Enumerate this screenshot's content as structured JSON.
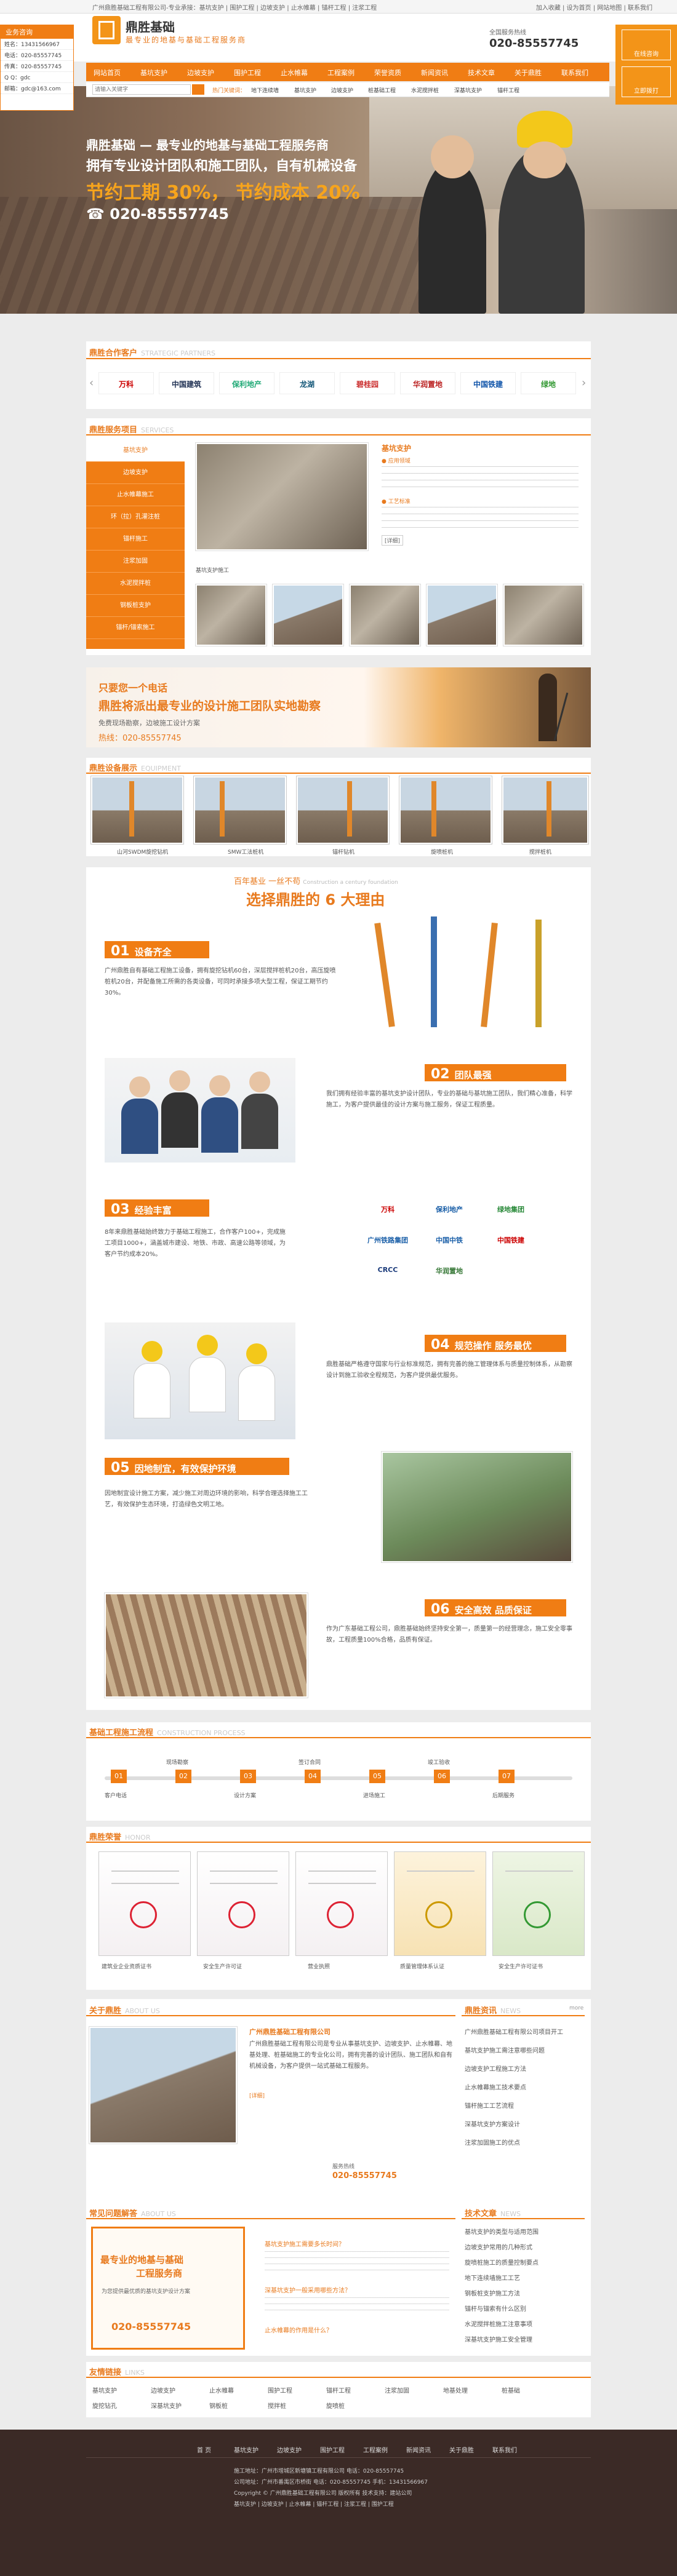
{
  "topbar": {
    "left": "广州鼎胜基础工程有限公司-专业承接：基坑支护 | 围护工程 | 边坡支护 | 止水帷幕 | 锚杆工程 | 注浆工程",
    "right": "加入收藏 | 设为首页 | 网站地图 | 联系我们"
  },
  "header": {
    "name": "鼎胜基础",
    "slogan": "最专业的地基与基础工程服务商",
    "hotline_label": "全国服务热线",
    "hotline": "020-85557745"
  },
  "nav": [
    "网站首页",
    "基坑支护",
    "边坡支护",
    "围护工程",
    "止水帷幕",
    "工程案例",
    "荣誉资质",
    "新闻资讯",
    "技术文章",
    "关于鼎胜",
    "联系我们"
  ],
  "subnav": {
    "search_ph": "请输入关键字",
    "hot": "热门关键词：",
    "keys": [
      "地下连续墙",
      "基坑支护",
      "边坡支护",
      "桩基础工程",
      "水泥搅拌桩",
      "深基坑支护",
      "锚杆工程"
    ]
  },
  "leftbox": {
    "title": "业务咨询",
    "rows": [
      "姓名：13431566967",
      "电话：020-85557745",
      "传真：020-85557745",
      "Q Q：gdc",
      "邮箱：gdc@163.com"
    ]
  },
  "floatr": {
    "b1": "在线咨询",
    "b2": "立即拨打"
  },
  "hero": {
    "t1": "鼎胜基础 — 最专业的地基与基础工程服务商",
    "t2": "拥有专业设计团队和施工团队，自有机械设备",
    "t3": "节约工期 30%， 节约成本 20%",
    "t4": "☎ 020-85557745"
  },
  "partners": {
    "title": "鼎胜合作客户",
    "en": "STRATEGIC PARTNERS",
    "items": [
      "万科",
      "中国建筑",
      "保利地产",
      "龙湖",
      "碧桂园",
      "华润置地",
      "中国铁建",
      "绿地"
    ]
  },
  "services": {
    "title": "鼎胜服务项目",
    "en": "SERVICES",
    "menu": [
      "基坑支护",
      "边坡支护",
      "止水帷幕施工",
      "环（拉）孔灌注桩",
      "锚杆施工",
      "注浆加固",
      "水泥搅拌桩",
      "钢板桩支护",
      "锚杆/锚索施工"
    ],
    "feature_title": "基坑支护",
    "feature_sub": "● 应用领域",
    "feature_sub2": "● 工艺标准",
    "feature_more": "[详细]",
    "caption": "基坑支护施工"
  },
  "banner2": {
    "t1": "只要您一个电话",
    "t2": "鼎胜将派出最专业的设计施工团队实地勘察",
    "t3": "免费现场勘察，边坡施工设计方案",
    "t4": "热线：020-85557745"
  },
  "equipment": {
    "title": "鼎胜设备展示",
    "en": "EQUIPMENT",
    "items": [
      "山河SWDM旋挖钻机",
      "SMW工法桩机",
      "锚杆钻机",
      "旋喷桩机",
      "搅拌桩机",
      "三轴搅拌桩机"
    ]
  },
  "why": {
    "top": "百年基业 一丝不苟",
    "top_en": "Construction a century foundation",
    "title": "选择鼎胜的 6 大理由",
    "reasons": [
      {
        "n": "01",
        "t": "设备齐全",
        "p": "广州鼎胜自有基础工程施工设备，拥有旋挖钻机60台，深层搅拌桩机20台，高压旋喷桩机20台，并配备施工所需的各类设备，可同时承接多项大型工程，保证工期节约30%。"
      },
      {
        "n": "02",
        "t": "团队最强",
        "p": "我们拥有经验丰富的基坑支护设计团队，专业的基础与基坑施工团队，我们精心准备，科学施工，为客户提供最佳的设计方案与施工服务，保证工程质量。"
      },
      {
        "n": "03",
        "t": "经验丰富",
        "p": "8年来鼎胜基础始终致力于基础工程施工，合作客户100+，完成施工项目1000+，涵盖城市建设、地铁、市政、高速公路等领域，为客户节约成本20%。"
      },
      {
        "n": "04",
        "t": "规范操作 服务最优",
        "p": "鼎胜基础严格遵守国家与行业标准规范，拥有完善的施工管理体系与质量控制体系，从勘察设计到施工验收全程规范，为客户提供最优服务。"
      },
      {
        "n": "05",
        "t": "因地制宜，有效保护环境",
        "p": "因地制宜设计施工方案，减少施工对周边环境的影响，科学合理选择施工工艺，有效保护生态环境，打造绿色文明工地。"
      },
      {
        "n": "06",
        "t": "安全高效 品质保证",
        "p": "作为广东基础工程公司，鼎胜基础始终坚持安全第一，质量第一的经营理念，施工安全零事故，工程质量100%合格，品质有保证。"
      }
    ],
    "logos": [
      "万科",
      "保利地产",
      "绿地集团",
      "广州铁路集团",
      "中国中铁",
      "中国铁建",
      "CRCC",
      "华润置地"
    ]
  },
  "process": {
    "title": "基础工程施工流程",
    "en": "CONSTRUCTION PROCESS",
    "steps": [
      {
        "n": "01",
        "t": "客户电话"
      },
      {
        "n": "02",
        "t": "现场勘察"
      },
      {
        "n": "03",
        "t": "设计方案"
      },
      {
        "n": "04",
        "t": "签订合同"
      },
      {
        "n": "05",
        "t": "进场施工"
      },
      {
        "n": "06",
        "t": "竣工验收"
      },
      {
        "n": "07",
        "t": "后期服务"
      }
    ]
  },
  "honor": {
    "title": "鼎胜荣誉",
    "en": "HONOR",
    "items": [
      "建筑业企业资质证书",
      "安全生产许可证",
      "营业执照",
      "质量管理体系认证",
      "守合同重信用企业",
      "安全生产许可证书"
    ]
  },
  "about": {
    "title": "关于鼎胜",
    "en": "ABOUT US",
    "company": "广州鼎胜基础工程有限公司",
    "text": "广州鼎胜基础工程有限公司是专业从事基坑支护、边坡支护、止水帷幕、地基处理、桩基础施工的专业化公司，拥有完善的设计团队、施工团队和自有机械设备，为客户提供一站式基础工程服务。",
    "more": "[详细]",
    "hotline_label": "服务热线",
    "hotline": "020-85557745"
  },
  "news": {
    "title": "鼎胜资讯",
    "en": "NEWS",
    "more": "more",
    "items": [
      "广州鼎胜基础工程有限公司项目开工",
      "基坑支护施工需注意哪些问题",
      "边坡支护工程施工方法",
      "止水帷幕施工技术要点",
      "锚杆施工工艺流程",
      "深基坑支护方案设计",
      "注浆加固施工的优点"
    ]
  },
  "contact": {
    "title": "常见问题解答",
    "en": "ABOUT US",
    "card_t1": "最专业的地基与基础",
    "card_t2": "工程服务商",
    "card_t3": "为您提供最优质的基坑支护设计方案",
    "card_hot": "020-85557745",
    "faq": [
      "基坑支护施工需要多长时间？",
      "深基坑支护一般采用哪些方法？",
      "止水帷幕的作用是什么？"
    ]
  },
  "tech": {
    "title": "技术文章",
    "en": "NEWS",
    "items": [
      "基坑支护的类型与适用范围",
      "边坡支护常用的几种形式",
      "旋喷桩施工的质量控制要点",
      "地下连续墙施工工艺",
      "钢板桩支护施工方法",
      "锚杆与锚索有什么区别",
      "水泥搅拌桩施工注意事项",
      "深基坑支护施工安全管理"
    ]
  },
  "links": {
    "title": "友情链接",
    "en": "LINKS",
    "items": [
      "基坑支护",
      "边坡支护",
      "止水帷幕",
      "围护工程",
      "锚杆工程",
      "注浆加固",
      "地基处理",
      "桩基础",
      "旋挖钻孔",
      "深基坑支护",
      "钢板桩",
      "搅拌桩",
      "旋喷桩",
      "土钉墙",
      "地下连续墙",
      "预应力锚索"
    ]
  },
  "footer": {
    "nav": [
      "首 页",
      "基坑支护",
      "边坡支护",
      "围护工程",
      "工程案例",
      "新闻资讯",
      "关于鼎胜",
      "联系我们"
    ],
    "l1": "施工地址：广州市增城区新塘镇工程有限公司 电话：020-85557745",
    "l2": "公司地址：广州市番禺区市桥街 电话：020-85557745 手机：13431566967",
    "l3": "Copyright © 广州鼎胜基础工程有限公司 版权所有 技术支持：建站公司",
    "l4": "基坑支护 | 边坡支护 | 止水帷幕 | 锚杆工程 | 注浆工程 | 围护工程"
  }
}
